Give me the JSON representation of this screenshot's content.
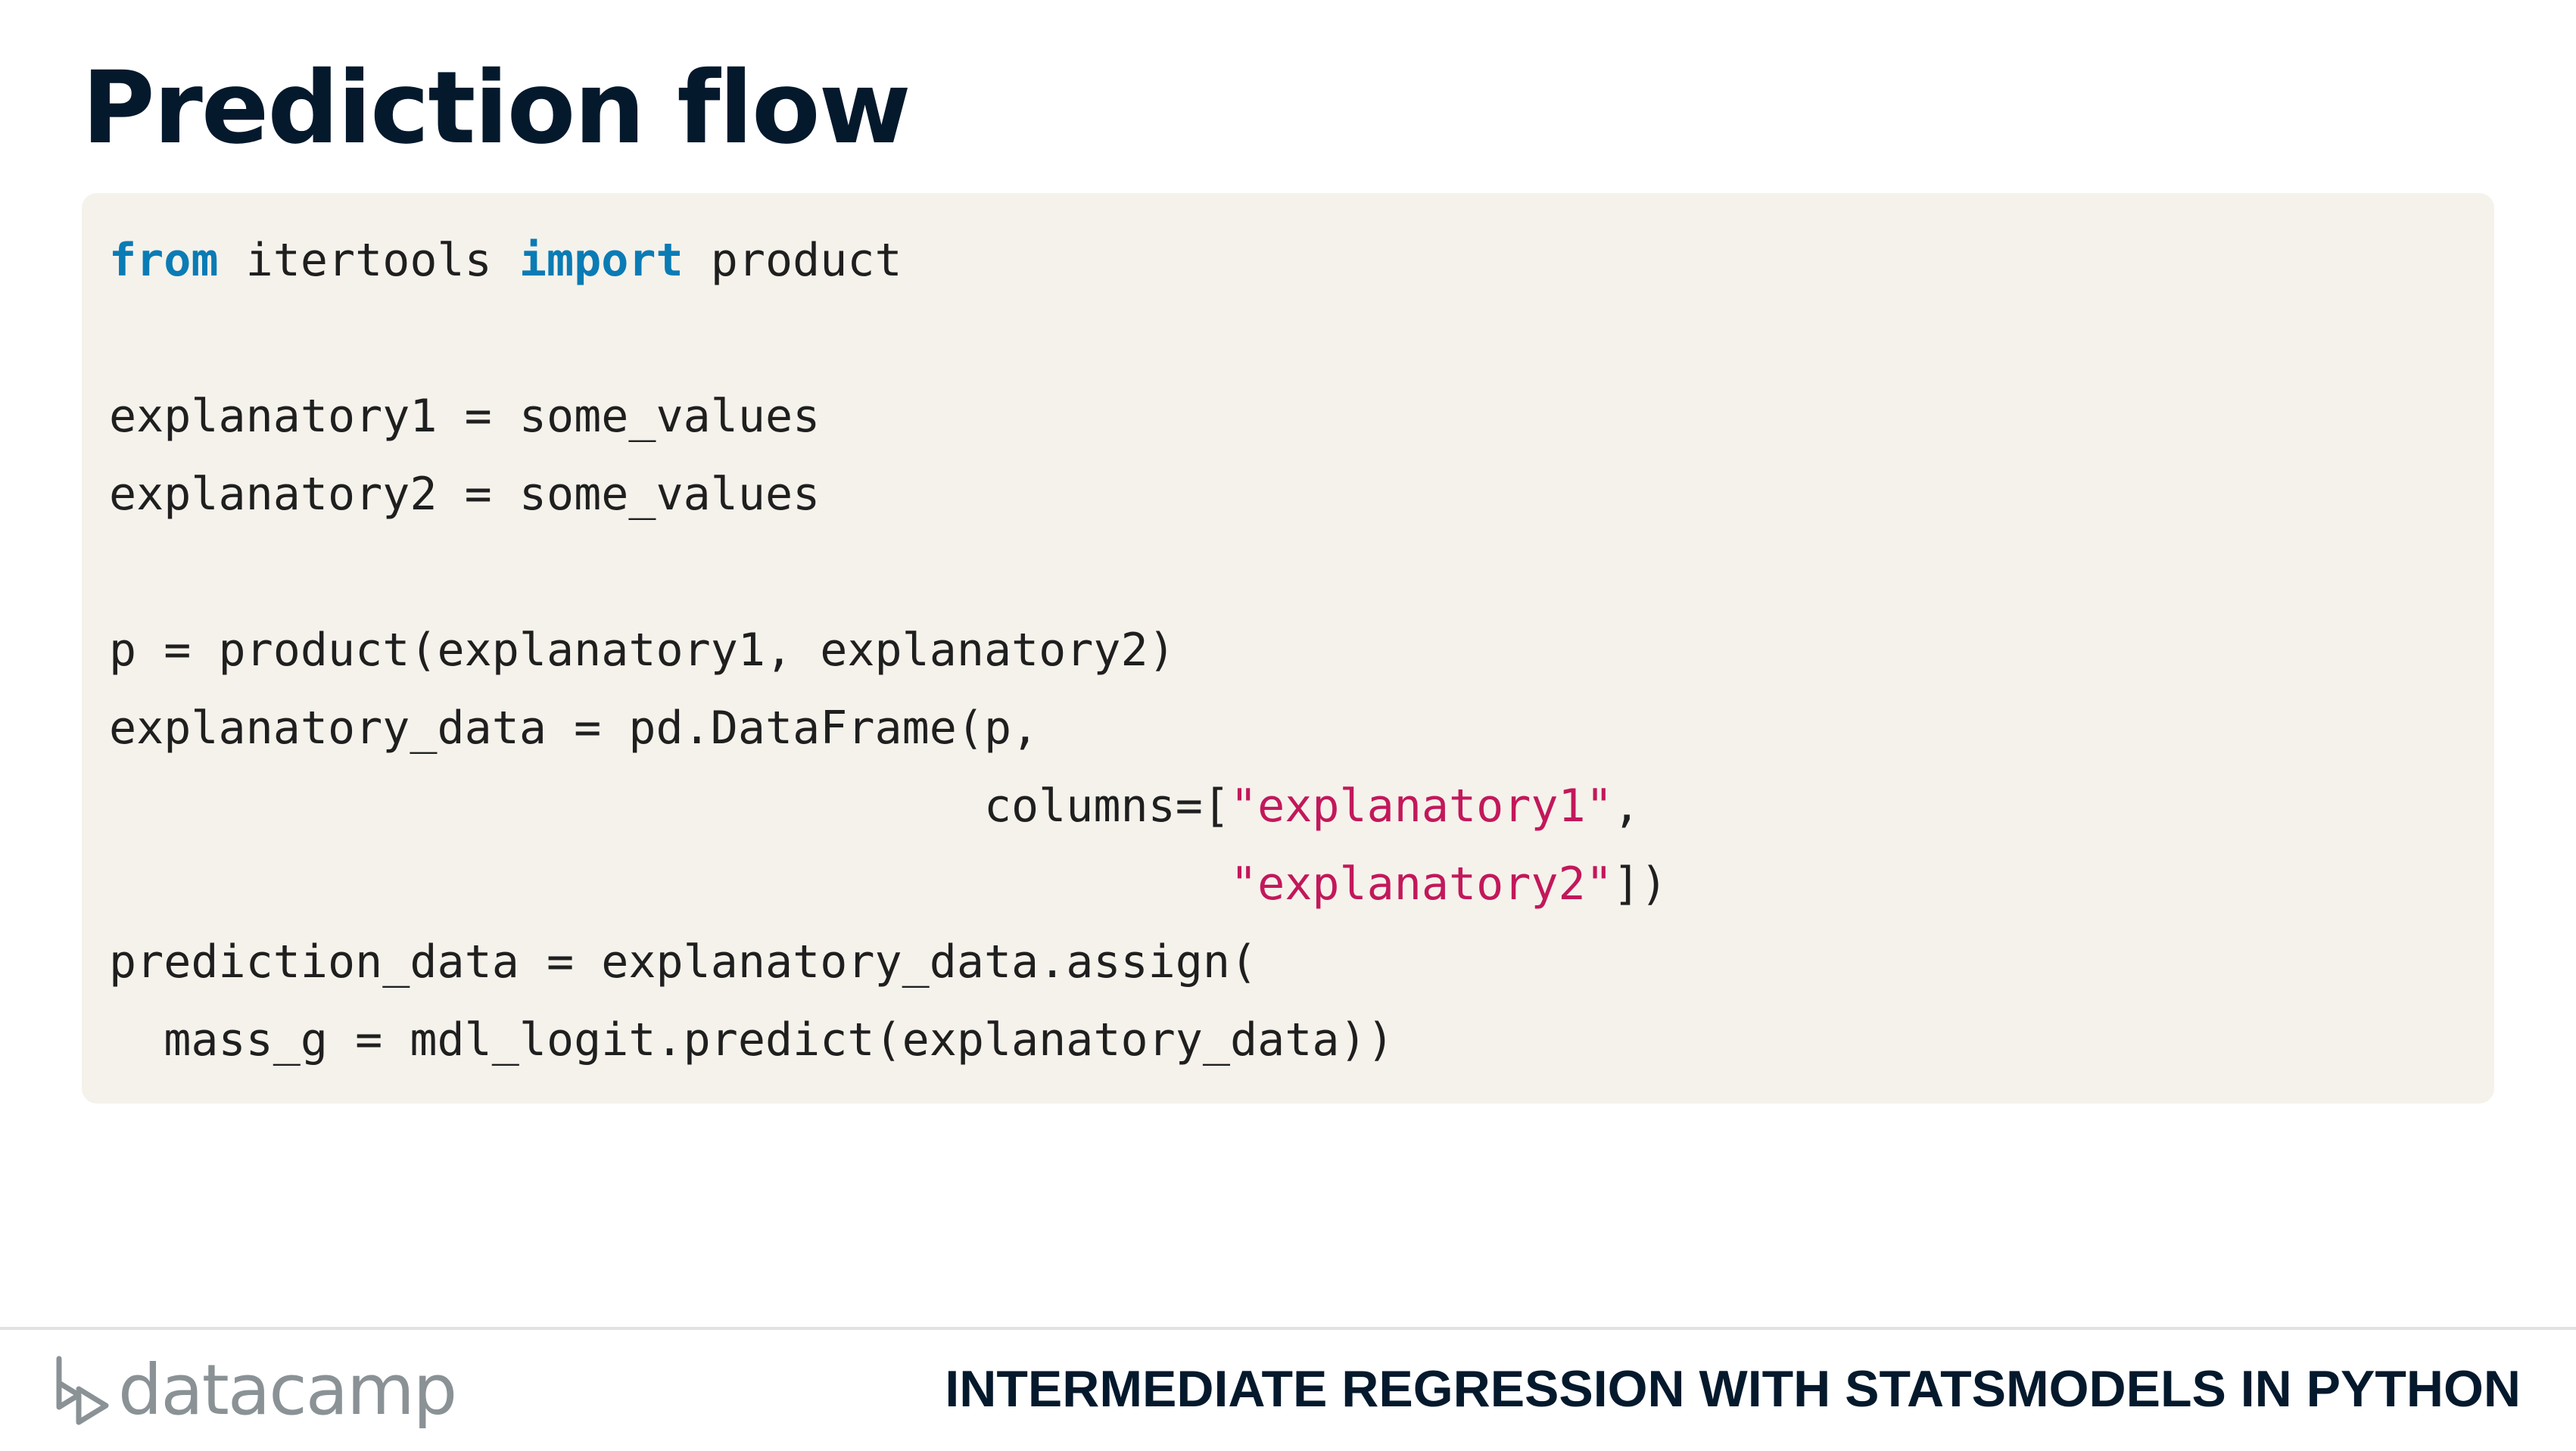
{
  "slide": {
    "title": "Prediction flow"
  },
  "code": {
    "lines": [
      [
        {
          "t": "from",
          "c": "kw"
        },
        {
          "t": " itertools "
        },
        {
          "t": "import",
          "c": "kw"
        },
        {
          "t": " product"
        }
      ],
      [],
      [
        {
          "t": "explanatory1 = some_values"
        }
      ],
      [
        {
          "t": "explanatory2 = some_values"
        }
      ],
      [],
      [
        {
          "t": "p = product(explanatory1, explanatory2)"
        }
      ],
      [
        {
          "t": "explanatory_data = pd.DataFrame(p,"
        }
      ],
      [
        {
          "t": "                                columns=["
        },
        {
          "t": "\"explanatory1\"",
          "c": "str"
        },
        {
          "t": ","
        }
      ],
      [
        {
          "t": "                                         "
        },
        {
          "t": "\"explanatory2\"",
          "c": "str"
        },
        {
          "t": "])"
        }
      ],
      [
        {
          "t": "prediction_data = explanatory_data.assign("
        }
      ],
      [
        {
          "t": "  mass_g = mdl_logit.predict(explanatory_data))"
        }
      ]
    ]
  },
  "footer": {
    "brand": "datacamp",
    "course_title": "INTERMEDIATE REGRESSION WITH STATSMODELS IN PYTHON"
  },
  "colors": {
    "title": "#05192d",
    "code_background": "#f5f2eb",
    "keyword": "#0a7bb5",
    "string": "#c2185b",
    "logo": "#8a9296"
  }
}
